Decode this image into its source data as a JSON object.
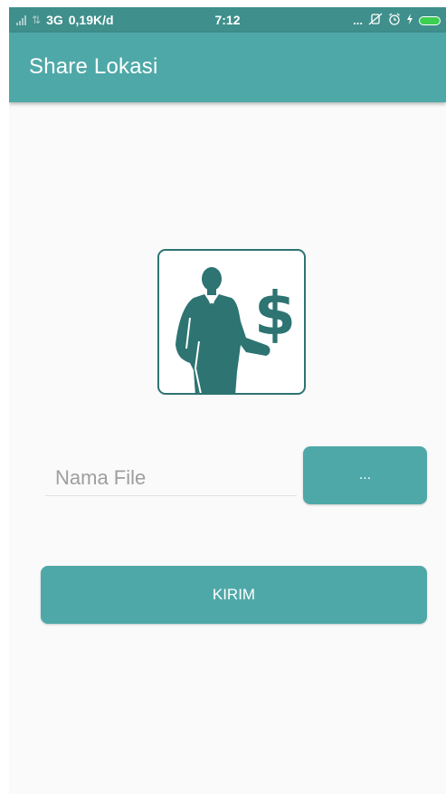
{
  "status_bar": {
    "network": "3G",
    "speed": "0,19K/d",
    "time": "7:12",
    "more": "...",
    "icons": [
      "signal-icon",
      "data-arrows-icon",
      "vibrate-off-icon",
      "alarm-icon",
      "charging-icon",
      "battery-icon"
    ]
  },
  "app_bar": {
    "title": "Share Lokasi"
  },
  "logo": {
    "icon": "businessman-dollar-icon",
    "dollar_glyph": "$"
  },
  "form": {
    "file_name_placeholder": "Nama File",
    "file_name_value": "",
    "browse_label": "...",
    "send_label": "KIRIM"
  },
  "colors": {
    "status_bar": "#3f8f8c",
    "primary": "#4fa8a8",
    "logo_fill": "#2d7472",
    "background": "#fafafa"
  }
}
